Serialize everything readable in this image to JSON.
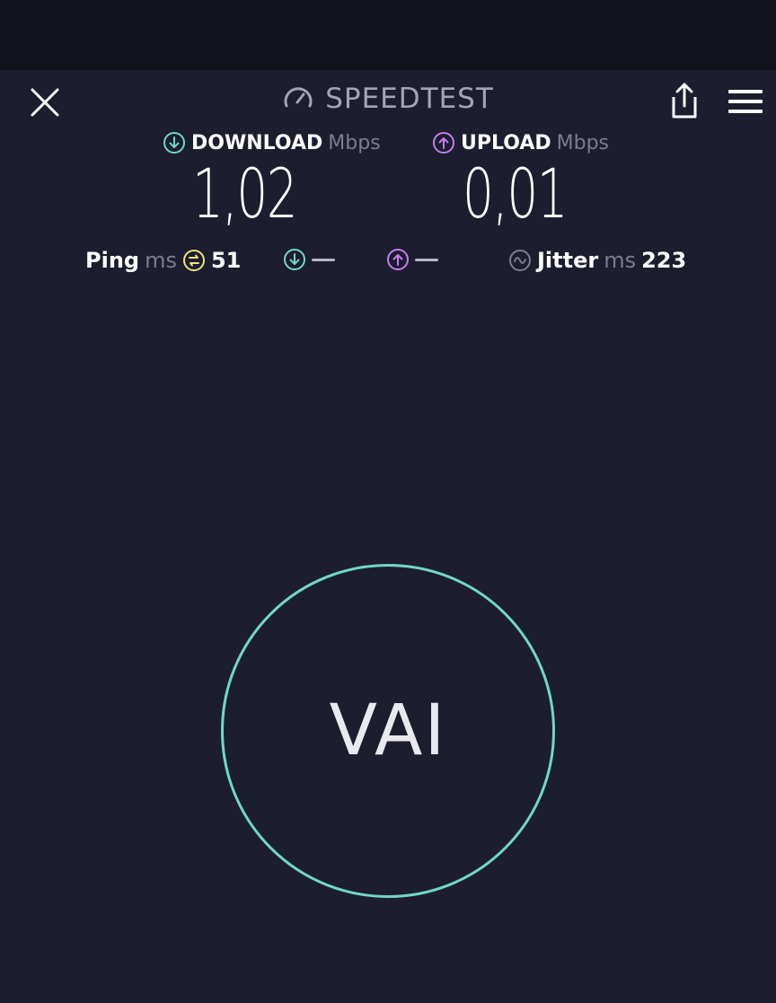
{
  "app": {
    "title": "SPEEDTEST"
  },
  "icons": {
    "close": "close-icon",
    "brand": "speedometer-icon",
    "share": "share-icon",
    "menu": "hamburger-menu-icon",
    "download": "download-arrow-icon",
    "upload": "upload-arrow-icon",
    "ping": "ping-icon",
    "jitter": "jitter-icon"
  },
  "colors": {
    "background": "#1c1d2e",
    "status_bar": "#11121c",
    "download_accent": "#6fd8c6",
    "upload_accent": "#c27cf0",
    "ping_accent": "#f2e07a",
    "go_ring": "#6fd8c6"
  },
  "download": {
    "label": "DOWNLOAD",
    "unit": "Mbps",
    "value": "1,02"
  },
  "upload": {
    "label": "UPLOAD",
    "unit": "Mbps",
    "value": "0,01"
  },
  "stats": {
    "ping": {
      "label": "Ping",
      "unit": "ms",
      "value": "51"
    },
    "jitter": {
      "label": "Jitter",
      "unit": "ms",
      "value": "223"
    }
  },
  "go_button": {
    "label": "VAI"
  }
}
